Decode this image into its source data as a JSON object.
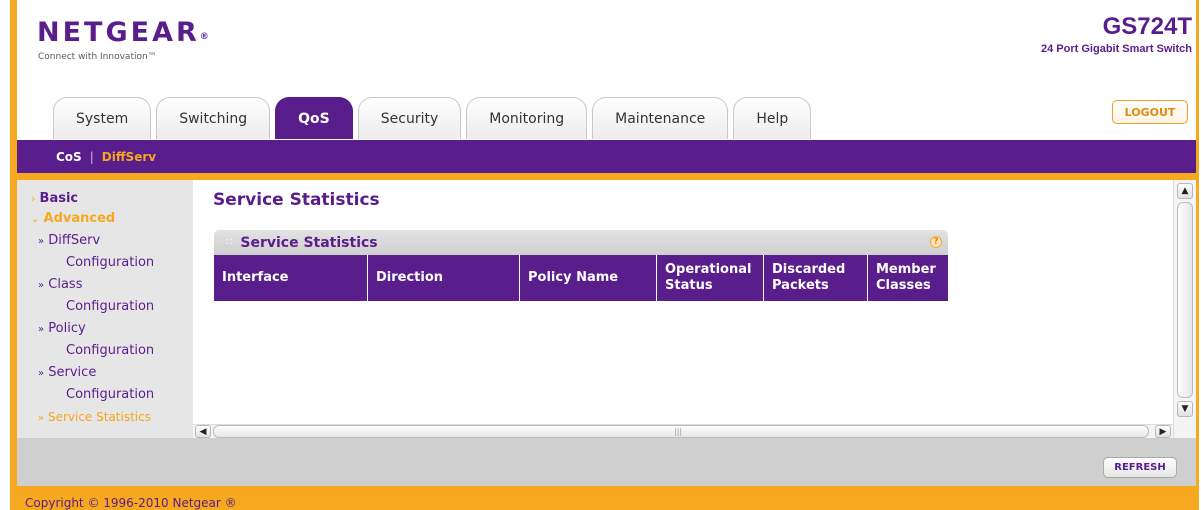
{
  "header": {
    "logo": "NETGEAR",
    "logo_mark": "®",
    "tagline": "Connect with Innovation™",
    "model": "GS724T",
    "model_desc": "24 Port Gigabit Smart Switch",
    "logout": "LOGOUT"
  },
  "tabs": [
    {
      "label": "System",
      "active": false
    },
    {
      "label": "Switching",
      "active": false
    },
    {
      "label": "QoS",
      "active": true
    },
    {
      "label": "Security",
      "active": false
    },
    {
      "label": "Monitoring",
      "active": false
    },
    {
      "label": "Maintenance",
      "active": false
    },
    {
      "label": "Help",
      "active": false
    }
  ],
  "subnav": {
    "items": [
      "CoS",
      "DiffServ"
    ],
    "separator": "|",
    "active": "DiffServ"
  },
  "sidebar": {
    "basic": "Basic",
    "advanced": "Advanced",
    "items": [
      {
        "line1": "DiffServ",
        "line2": "Configuration"
      },
      {
        "line1": "Class",
        "line2": "Configuration"
      },
      {
        "line1": "Policy",
        "line2": "Configuration"
      },
      {
        "line1": "Service",
        "line2": "Configuration"
      },
      {
        "line1": "Service Statistics",
        "active": true
      }
    ]
  },
  "main": {
    "page_title": "Service Statistics",
    "panel_title": "Service Statistics",
    "help": "?",
    "table": {
      "headers": [
        {
          "line1": "Interface",
          "line2": ""
        },
        {
          "line1": "Direction",
          "line2": ""
        },
        {
          "line1": "Policy Name",
          "line2": ""
        },
        {
          "line1": "Operational",
          "line2": "Status"
        },
        {
          "line1": "Discarded",
          "line2": "Packets"
        },
        {
          "line1": "Member",
          "line2": "Classes"
        }
      ],
      "rows": []
    }
  },
  "actions": {
    "refresh": "REFRESH"
  },
  "footer": {
    "copyright": "Copyright © 1996-2010 Netgear ®"
  },
  "colors": {
    "brand_purple": "#5a1d8c",
    "brand_orange": "#f6a81e",
    "panel_gray": "#cfcfcf"
  },
  "icons": {
    "help": "help-icon",
    "scroll_up": "chevron-up-icon",
    "scroll_down": "chevron-down-icon",
    "scroll_left": "chevron-left-icon",
    "scroll_right": "chevron-right-icon",
    "nav_collapsed": "chevron-right-icon",
    "nav_expanded": "chevron-down-icon",
    "nav_bullet": "double-chevron-icon"
  }
}
